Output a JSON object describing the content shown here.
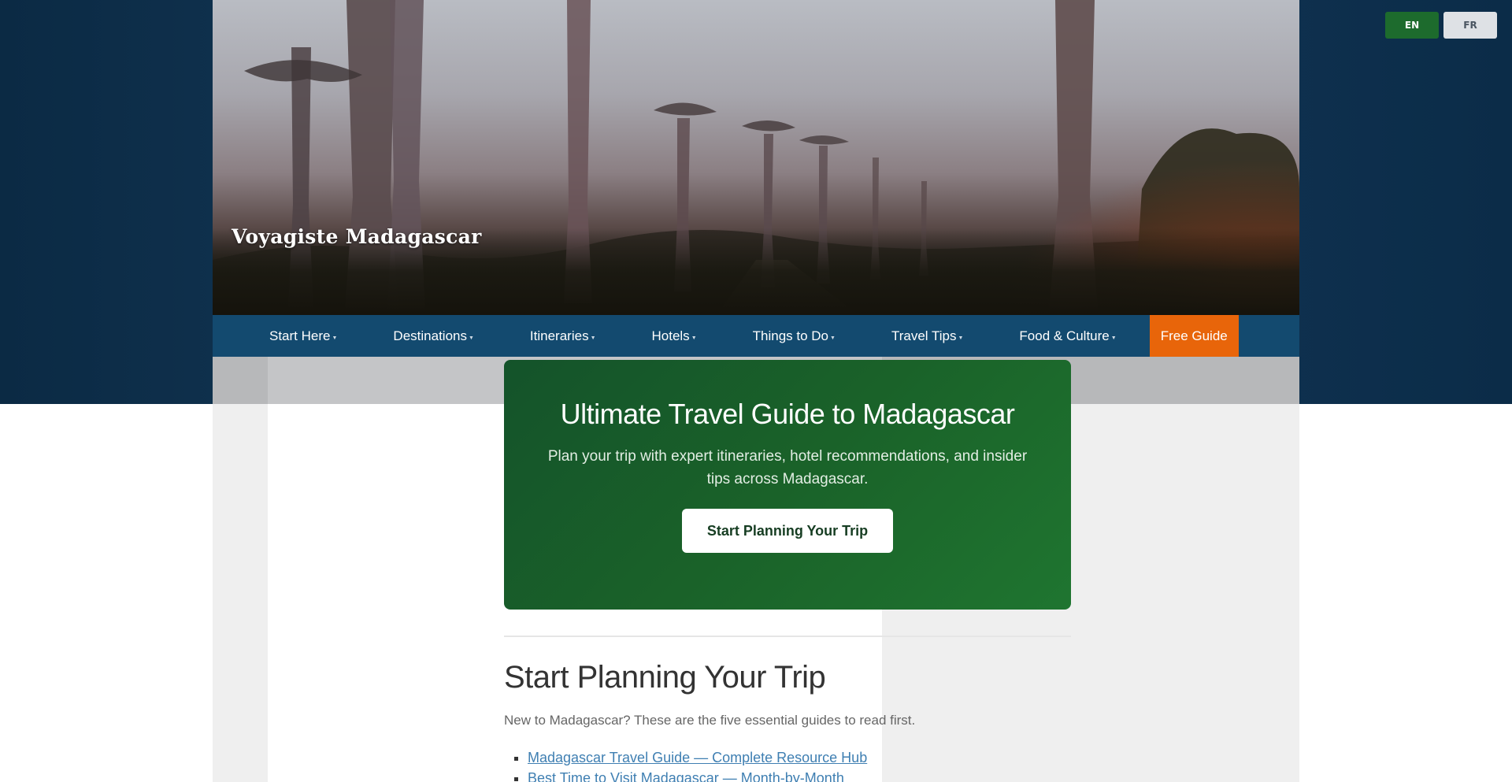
{
  "site": {
    "title": "Voyagiste Madagascar"
  },
  "language_switcher": {
    "options": [
      {
        "label": "EN",
        "active": true
      },
      {
        "label": "FR",
        "active": false
      }
    ]
  },
  "nav": {
    "items": [
      {
        "label": "Start Here"
      },
      {
        "label": "Destinations"
      },
      {
        "label": "Itineraries"
      },
      {
        "label": "Hotels"
      },
      {
        "label": "Things to Do"
      },
      {
        "label": "Travel Tips"
      },
      {
        "label": "Food & Culture"
      }
    ],
    "cta": "Free Guide",
    "caret_icon": "chevron-down-icon"
  },
  "hero_card": {
    "title": "Ultimate Travel Guide to Madagascar",
    "subtitle": "Plan your trip with expert itineraries, hotel recommendations, and insider tips across Madagascar.",
    "button": "Start Planning Your Trip"
  },
  "section": {
    "title": "Start Planning Your Trip",
    "intro": "New to Madagascar? These are the five essential guides to read first.",
    "links": [
      "Madagascar Travel Guide — Complete Resource Hub",
      "Best Time to Visit Madagascar — Month-by-Month"
    ]
  },
  "colors": {
    "nav_bg": "#134a6f",
    "cta_orange": "#e8650a",
    "card_green": "#1a6229",
    "lang_active": "#1d6b2d",
    "link": "#3f7fb2"
  }
}
